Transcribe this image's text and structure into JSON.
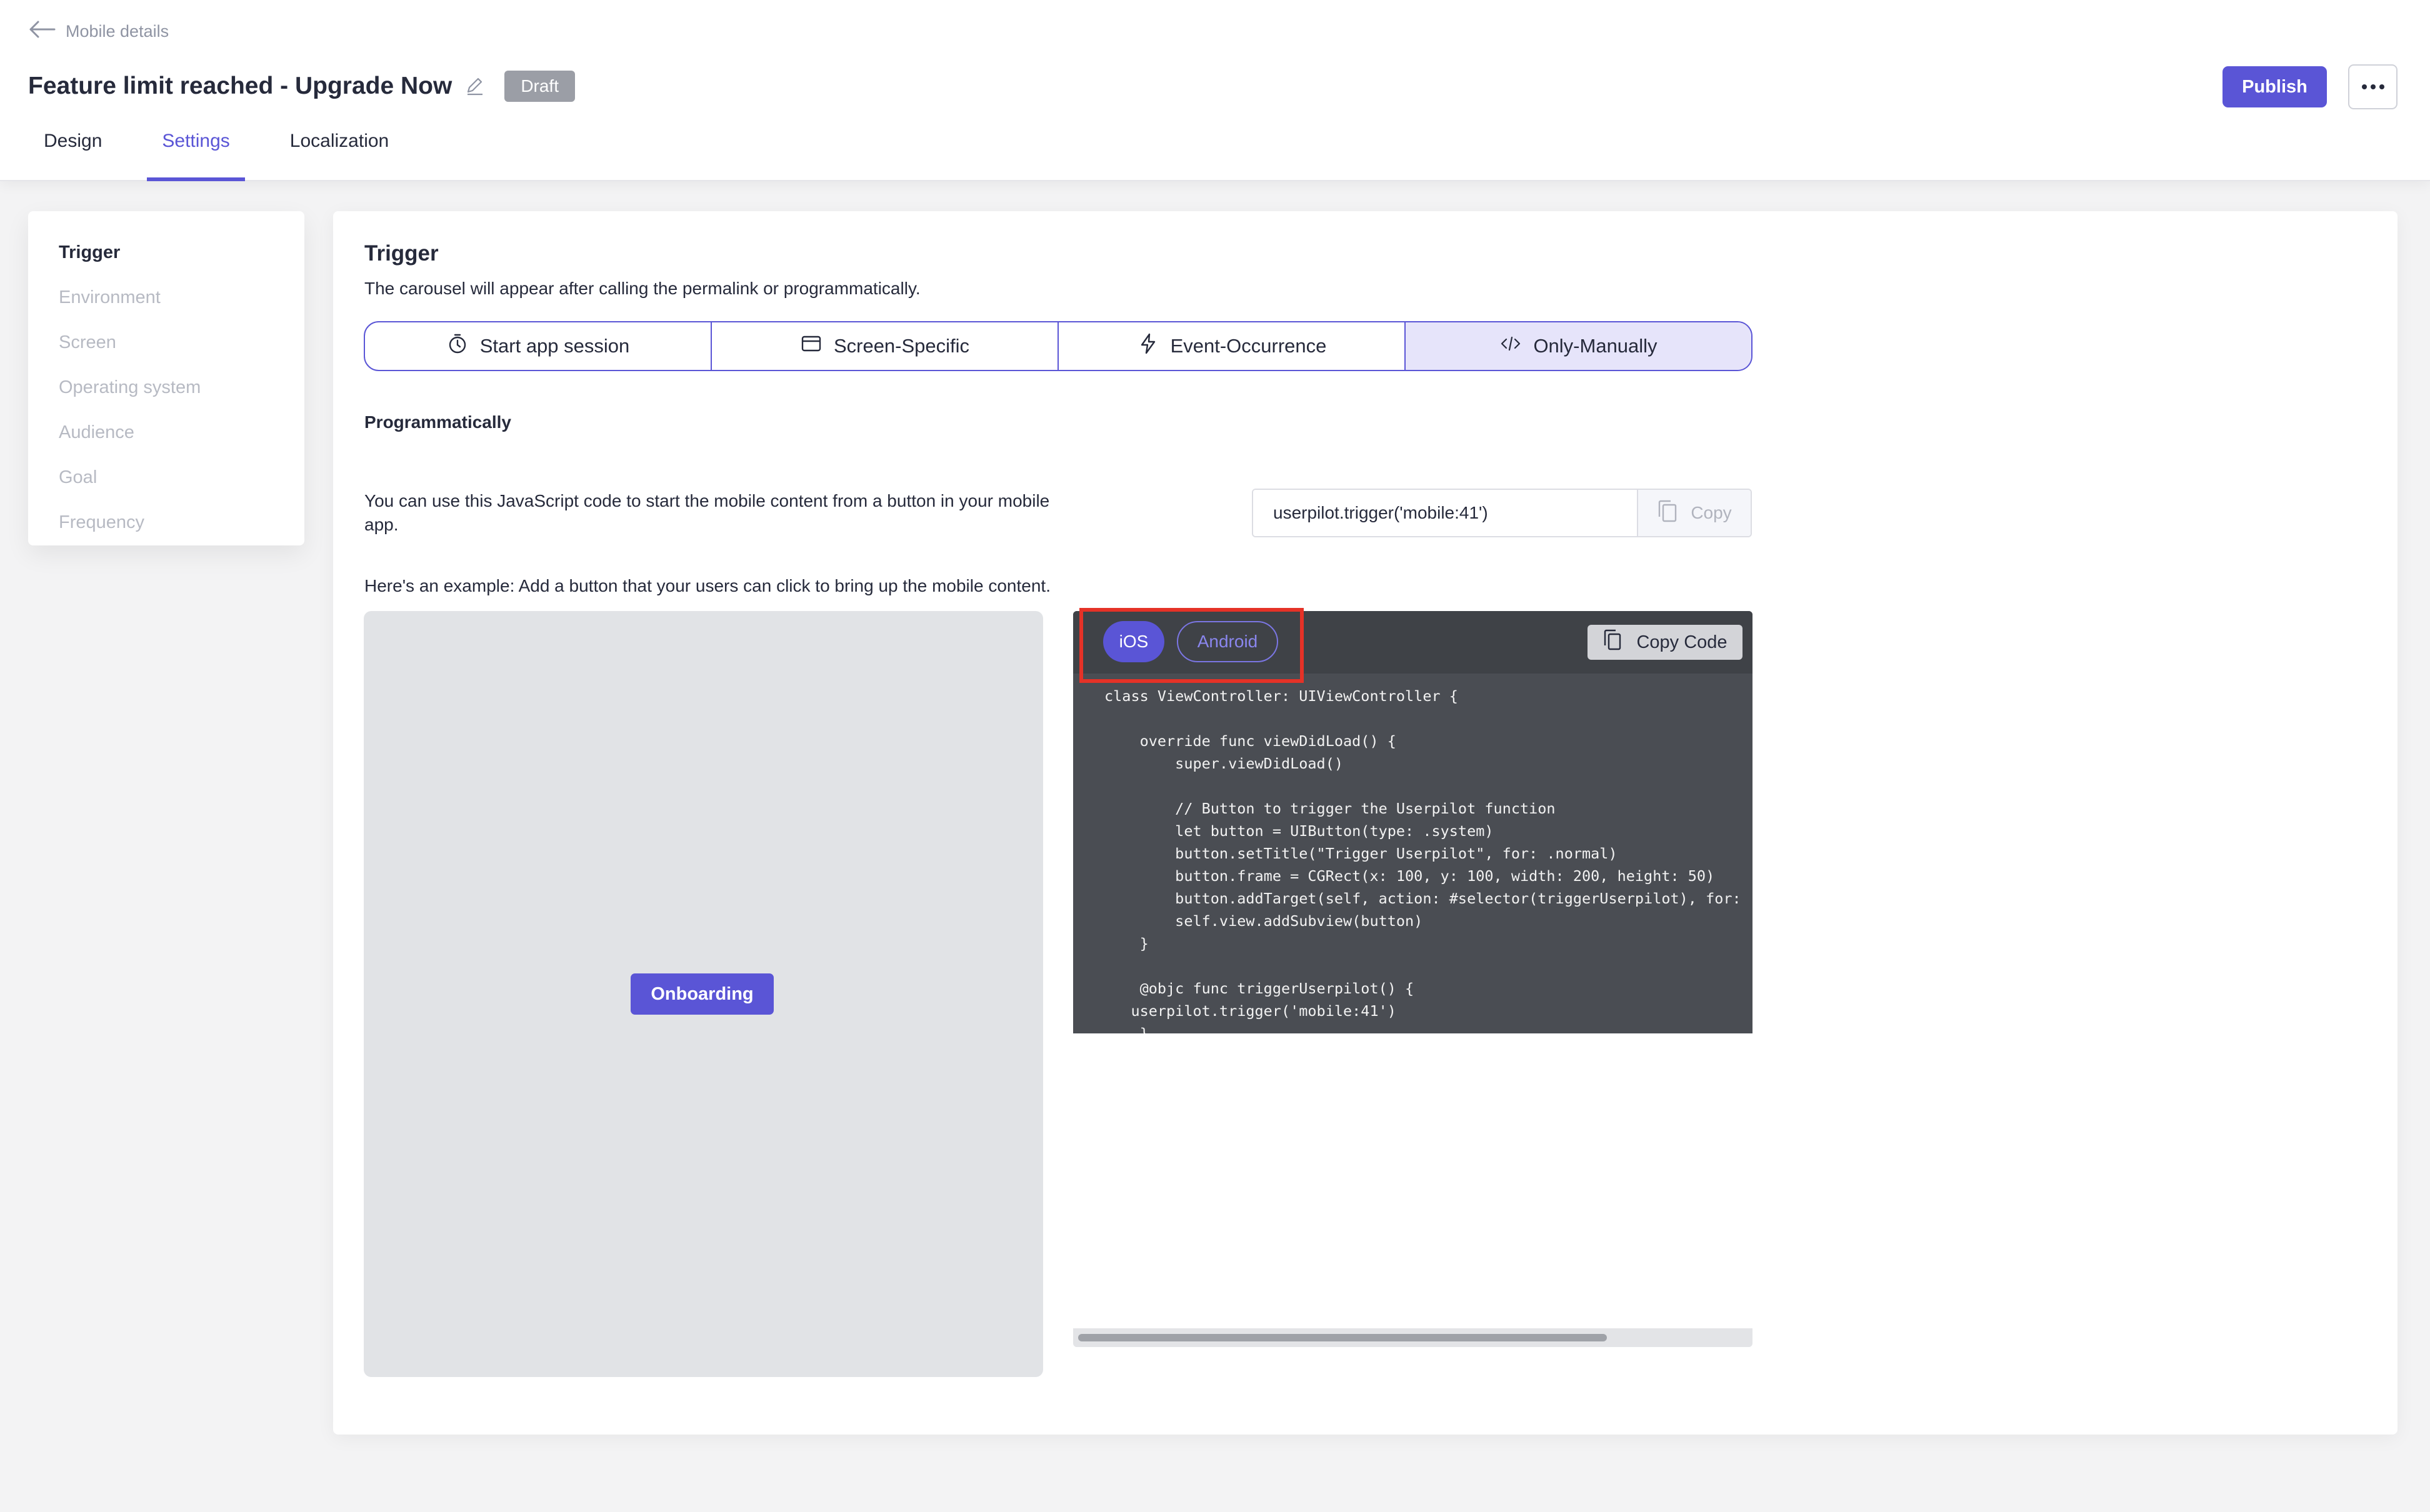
{
  "header": {
    "back_label": "Mobile details",
    "title": "Feature limit reached - Upgrade Now",
    "status_badge": "Draft",
    "publish_label": "Publish",
    "tabs": [
      {
        "label": "Design"
      },
      {
        "label": "Settings",
        "active": true
      },
      {
        "label": "Localization"
      }
    ]
  },
  "sidebar": {
    "items": [
      {
        "label": "Trigger",
        "active": true
      },
      {
        "label": "Environment"
      },
      {
        "label": "Screen"
      },
      {
        "label": "Operating system"
      },
      {
        "label": "Audience"
      },
      {
        "label": "Goal"
      },
      {
        "label": "Frequency"
      }
    ]
  },
  "trigger": {
    "title": "Trigger",
    "subtitle": "The carousel will appear after calling the permalink or programmatically.",
    "options": [
      {
        "label": "Start app session",
        "icon": "clock-icon"
      },
      {
        "label": "Screen-Specific",
        "icon": "window-icon"
      },
      {
        "label": "Event-Occurrence",
        "icon": "lightning-icon"
      },
      {
        "label": "Only-Manually",
        "icon": "code-icon",
        "active": true
      }
    ],
    "programmatically_label": "Programmatically",
    "description": "You can use this JavaScript code to start the mobile content from a button in your mobile app.",
    "snippet": "userpilot.trigger('mobile:41')",
    "copy_label": "Copy",
    "example_text": "Here's an example: Add a button that your users can click to bring up the mobile content."
  },
  "preview": {
    "button_label": "Onboarding"
  },
  "code_panel": {
    "platforms": [
      "iOS",
      "Android"
    ],
    "selected_platform": "iOS",
    "copy_code_label": "Copy Code",
    "code": "class ViewController: UIViewController {\n\n    override func viewDidLoad() {\n        super.viewDidLoad()\n\n        // Button to trigger the Userpilot function\n        let button = UIButton(type: .system)\n        button.setTitle(\"Trigger Userpilot\", for: .normal)\n        button.frame = CGRect(x: 100, y: 100, width: 200, height: 50)\n        button.addTarget(self, action: #selector(triggerUserpilot), for: .touchUpInside)\n        self.view.addSubview(button)\n    }\n\n    @objc func triggerUserpilot() {\n   userpilot.trigger('mobile:41')\n    }\n}"
  },
  "colors": {
    "accent": "#5a55d6",
    "highlight": "#e53227",
    "code_background": "#4a4d53"
  }
}
